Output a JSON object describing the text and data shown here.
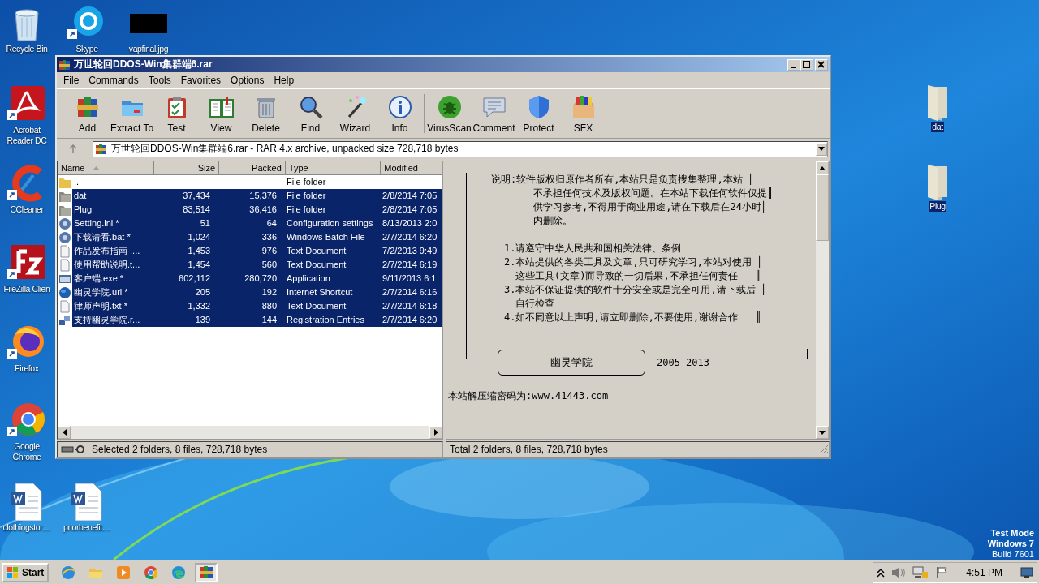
{
  "desktop": {
    "icons": [
      {
        "label": "Recycle Bin",
        "selected": false
      },
      {
        "label": "Skype",
        "selected": false
      },
      {
        "label": "vapfinal.jpg",
        "selected": false
      },
      {
        "label": "Acrobat Reader DC",
        "selected": false
      },
      {
        "label": "CCleaner",
        "selected": false
      },
      {
        "label": "FileZilla Clien",
        "selected": false
      },
      {
        "label": "Firefox",
        "selected": false
      },
      {
        "label": "Google Chrome",
        "selected": false
      },
      {
        "label": "clothingstor…",
        "selected": false
      },
      {
        "label": "priorbenefit…",
        "selected": false
      },
      {
        "label": "dat",
        "selected": true
      },
      {
        "label": "Plug",
        "selected": true
      }
    ]
  },
  "window": {
    "title": "万世轮回DDOS-Win集群端6.rar"
  },
  "menu": [
    "File",
    "Commands",
    "Tools",
    "Favorites",
    "Options",
    "Help"
  ],
  "toolbar": [
    "Add",
    "Extract To",
    "Test",
    "View",
    "Delete",
    "Find",
    "Wizard",
    "Info",
    "VirusScan",
    "Comment",
    "Protect",
    "SFX"
  ],
  "address": "万世轮回DDOS-Win集群端6.rar - RAR 4.x archive, unpacked size 728,718 bytes",
  "file_list": {
    "columns": [
      {
        "label": "Name",
        "sorted": true
      },
      {
        "label": "Size",
        "sorted": false
      },
      {
        "label": "Packed",
        "sorted": false
      },
      {
        "label": "Type",
        "sorted": false
      },
      {
        "label": "Modified",
        "sorted": false
      }
    ],
    "rows": [
      {
        "kind": "parent",
        "name": "..",
        "size": "",
        "packed": "",
        "type": "File folder",
        "modified": "",
        "selected": false
      },
      {
        "kind": "folder",
        "name": "dat",
        "size": "37,434",
        "packed": "15,376",
        "type": "File folder",
        "modified": "2/8/2014 7:05",
        "selected": true
      },
      {
        "kind": "folder",
        "name": "Plug",
        "size": "83,514",
        "packed": "36,416",
        "type": "File folder",
        "modified": "2/8/2014 7:05",
        "selected": true
      },
      {
        "kind": "settings",
        "name": "Setting.ini *",
        "size": "51",
        "packed": "64",
        "type": "Configuration settings",
        "modified": "8/13/2013 2:0",
        "selected": true
      },
      {
        "kind": "settings",
        "name": "下载请看.bat *",
        "size": "1,024",
        "packed": "336",
        "type": "Windows Batch File",
        "modified": "2/7/2014 6:20",
        "selected": true
      },
      {
        "kind": "text",
        "name": "作品发布指南 ....",
        "size": "1,453",
        "packed": "976",
        "type": "Text Document",
        "modified": "7/2/2013 9:49",
        "selected": true
      },
      {
        "kind": "text",
        "name": "使用帮助说明.t...",
        "size": "1,454",
        "packed": "560",
        "type": "Text Document",
        "modified": "2/7/2014 6:19",
        "selected": true
      },
      {
        "kind": "app",
        "name": "客户端.exe *",
        "size": "602,112",
        "packed": "280,720",
        "type": "Application",
        "modified": "9/11/2013 6:1",
        "selected": true
      },
      {
        "kind": "link",
        "name": "幽灵学院.url *",
        "size": "205",
        "packed": "192",
        "type": "Internet Shortcut",
        "modified": "2/7/2014 6:16",
        "selected": true
      },
      {
        "kind": "text",
        "name": "律师声明.txt *",
        "size": "1,332",
        "packed": "880",
        "type": "Text Document",
        "modified": "2/7/2014 6:18",
        "selected": true
      },
      {
        "kind": "registry",
        "name": "支持幽灵学院.r...",
        "size": "139",
        "packed": "144",
        "type": "Registration Entries",
        "modified": "2/7/2014 6:20",
        "selected": true
      }
    ]
  },
  "comment": {
    "notice": [
      "说明:软件版权归原作者所有,本站只是负责搜集整理,本站 ║",
      "不承担任何技术及版权问题。在本站下载任何软件仅提║",
      "供学习参考,不得用于商业用途,请在下载后在24小时║",
      "内删除。"
    ],
    "rules": [
      {
        "kind": "item",
        "text": "1.请遵守中华人民共和国相关法律、条例"
      },
      {
        "kind": "item",
        "text": "2.本站提供的各类工具及文章,只可研究学习,本站对使用 ║"
      },
      {
        "kind": "cont",
        "text": "这些工具(文章)而导致的一切后果,不承担任何责任   ║"
      },
      {
        "kind": "item",
        "text": "3.本站不保证提供的软件十分安全或是完全可用,请下载后 ║"
      },
      {
        "kind": "cont",
        "text": "自行检查"
      },
      {
        "kind": "item",
        "text": "4.如不同意以上声明,请立即删除,不要使用,谢谢合作   ║"
      }
    ],
    "signature": "幽灵学院",
    "years": "2005-2013",
    "password_line": "本站解压缩密码为:www.41443.com"
  },
  "status_bar": {
    "selected": "Selected 2 folders, 8 files, 728,718 bytes",
    "total": "Total 2 folders, 8 files, 728,718 bytes"
  },
  "os_notice": [
    "Test Mode",
    "Windows 7",
    "Build 7601"
  ],
  "taskbar": {
    "start": "Start",
    "apps": [
      {
        "selected": false
      },
      {
        "selected": false
      },
      {
        "selected": false
      },
      {
        "selected": false
      },
      {
        "selected": false
      },
      {
        "selected": true
      }
    ],
    "clock": "4:51 PM"
  }
}
